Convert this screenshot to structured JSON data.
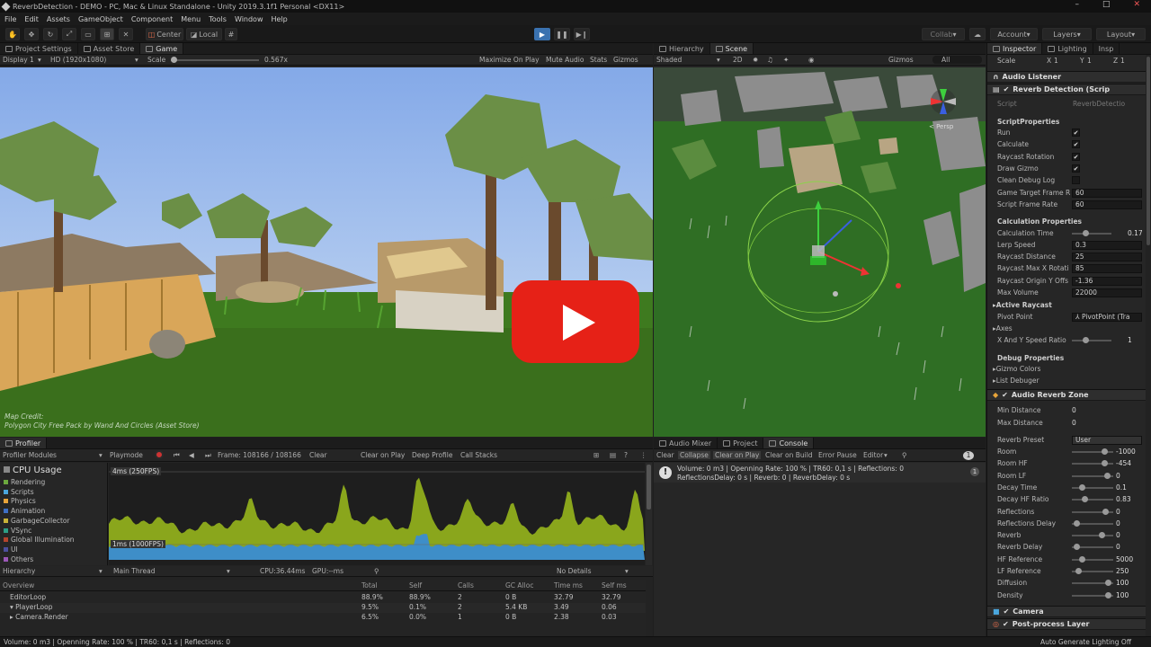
{
  "window": {
    "title": "ReverbDetection - DEMO - PC, Mac & Linux Standalone - Unity 2019.3.1f1 Personal <DX11>",
    "controls": [
      "–",
      "□",
      "✕"
    ]
  },
  "menu": [
    "File",
    "Edit",
    "Assets",
    "GameObject",
    "Component",
    "Menu",
    "Tools",
    "Window",
    "Help"
  ],
  "toolbar": {
    "center": "Center",
    "local": "Local",
    "collab": "Collab",
    "account": "Account",
    "layers": "Layers",
    "layout": "Layout"
  },
  "game": {
    "tabs": [
      "Project Settings",
      "Asset Store",
      "Game"
    ],
    "display": "Display 1",
    "resolution": "HD (1920x1080)",
    "scale_label": "Scale",
    "scale_value": "0.567x",
    "options": [
      "Maximize On Play",
      "Mute Audio",
      "Stats",
      "Gizmos"
    ],
    "credit_line1": "Map Credit:",
    "credit_line2": "Polygon City Free Pack by Wand And Circles (Asset Store)"
  },
  "scene": {
    "tabs": [
      "Hierarchy",
      "Scene"
    ],
    "shading": "Shaded",
    "mode2d": "2D",
    "gizmos": "Gizmos",
    "search": "All",
    "persp": "< Persp"
  },
  "profiler": {
    "tab": "Profiler",
    "modules": "Profiler Modules",
    "playmode": "Playmode",
    "frame": "Frame: 108166 / 108166",
    "buttons": [
      "Clear",
      "Clear on Play",
      "Deep Profile",
      "Call Stacks"
    ],
    "cpu_title": "CPU Usage",
    "legend": [
      {
        "label": "Rendering",
        "color": "#6ca83e"
      },
      {
        "label": "Scripts",
        "color": "#4aa6dd"
      },
      {
        "label": "Physics",
        "color": "#e8a43a"
      },
      {
        "label": "Animation",
        "color": "#3d6fc4"
      },
      {
        "label": "GarbageCollector",
        "color": "#c8b238"
      },
      {
        "label": "VSync",
        "color": "#2d9e86"
      },
      {
        "label": "Global Illumination",
        "color": "#b4442d"
      },
      {
        "label": "UI",
        "color": "#4c4f9e"
      },
      {
        "label": "Others",
        "color": "#9c58b8"
      }
    ],
    "label_top": "4ms (250FPS)",
    "label_bottom": "1ms (1000FPS)",
    "hier_view": "Hierarchy",
    "thread": "Main Thread",
    "cpu_time": "CPU:36.44ms",
    "gpu_time": "GPU:--ms",
    "details": "No Details",
    "columns": [
      "Overview",
      "Total",
      "Self",
      "Calls",
      "GC Alloc",
      "Time ms",
      "Self ms"
    ],
    "rows": [
      [
        "EditorLoop",
        "88.9%",
        "88.9%",
        "2",
        "0 B",
        "32.79",
        "32.79"
      ],
      [
        "▾ PlayerLoop",
        "9.5%",
        "0.1%",
        "2",
        "5.4 KB",
        "3.49",
        "0.06"
      ],
      [
        "  ▸ Camera.Render",
        "6.5%",
        "0.0%",
        "1",
        "0 B",
        "2.38",
        "0.03"
      ]
    ]
  },
  "console": {
    "tabs": [
      "Audio Mixer",
      "Project",
      "Console"
    ],
    "buttons": [
      "Clear",
      "Collapse",
      "Clear on Play",
      "Clear on Build",
      "Error Pause",
      "Editor"
    ],
    "badge": "1",
    "count": "1",
    "msg_line1": "Volume: 0 m3  |  Openning Rate: 100 %  |  TR60: 0,1 s  |  Reflections: 0",
    "msg_line2": "ReflectionsDelay: 0 s  |  Reverb: 0  |  ReverbDelay: 0 s"
  },
  "inspector": {
    "tabs": [
      "Inspector",
      "Lighting",
      "Insp"
    ],
    "scale": {
      "label": "Scale",
      "x": "X",
      "xv": "1",
      "y": "Y",
      "yv": "1",
      "z": "Z",
      "zv": "1"
    },
    "audio_listener": "Audio Listener",
    "reverb_script": "Reverb Detection (Scrip",
    "script_label": "Script",
    "script_value": "ReverbDetectio",
    "script_props": "ScriptProperties",
    "run": "Run",
    "calculate": "Calculate",
    "raycast_rotation": "Raycast Rotation",
    "draw_gizmo": "Draw Gizmo",
    "clean_debug": "Clean Debug Log",
    "target_fr_label": "Game Target Frame R",
    "target_fr": "60",
    "script_fr_label": "Script Frame Rate",
    "script_fr": "60",
    "calc_props": "Calculation Properties",
    "calc_time_label": "Calculation Time",
    "calc_time": "0.17",
    "lerp_label": "Lerp Speed",
    "lerp": "0.3",
    "ray_dist_label": "Raycast Distance",
    "ray_dist": "25",
    "ray_rot_label": "Raycast Max X Rotati",
    "ray_rot": "85",
    "ray_origin_label": "Raycast Origin Y Offs",
    "ray_origin": "-1.36",
    "max_vol_label": "Max Volume",
    "max_vol": "22000",
    "active_raycast": "Active Raycast",
    "pivot_label": "Pivot Point",
    "pivot": "⅄ PivotPoint (Tra",
    "axes": "Axes",
    "xy_label": "X And Y Speed Ratio",
    "xy": "1",
    "debug_props": "Debug Properties",
    "gizmo_colors": "Gizmo Colors",
    "list_debugger": "List Debuger",
    "reverb_zone": "Audio Reverb Zone",
    "min_dist_label": "Min Distance",
    "min_dist": "0",
    "max_dist_label": "Max Distance",
    "max_dist": "0",
    "preset_label": "Reverb Preset",
    "preset": "User",
    "room_label": "Room",
    "room": "-1000",
    "roomhf_label": "Room HF",
    "roomhf": "-454",
    "roomlf_label": "Room LF",
    "roomlf": "0",
    "decay_label": "Decay Time",
    "decay": "0.1",
    "decayhf_label": "Decay HF Ratio",
    "decayhf": "0.83",
    "refl_label": "Reflections",
    "refl": "0",
    "refldelay_label": "Reflections Delay",
    "refldelay": "0",
    "reverb_label": "Reverb",
    "reverb": "0",
    "reverbdelay_label": "Reverb Delay",
    "reverbdelay": "0",
    "hfref_label": "HF Reference",
    "hfref": "5000",
    "lfref_label": "LF Reference",
    "lfref": "250",
    "diffusion_label": "Diffusion",
    "diffusion": "100",
    "density_label": "Density",
    "density": "100",
    "camera": "Camera",
    "postprocess": "Post-process Layer"
  },
  "status": {
    "left": "Volume: 0 m3  |  Openning Rate: 100 %  |  TR60: 0,1 s  |  Reflections: 0",
    "right": "Auto Generate Lighting Off"
  }
}
